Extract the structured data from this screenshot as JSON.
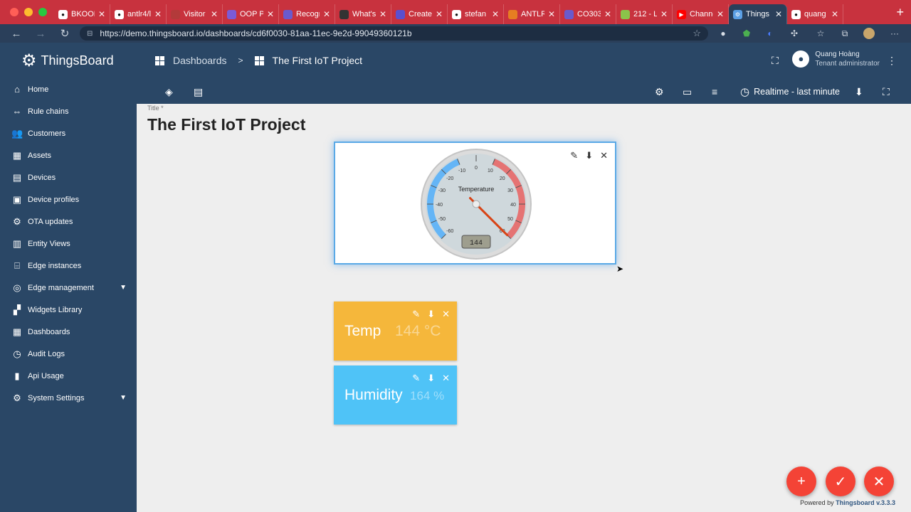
{
  "browser": {
    "tabs": [
      {
        "label": "BKOOL",
        "icon": "github-icon",
        "color": "#111111"
      },
      {
        "label": "antlr4/l",
        "icon": "github-icon",
        "color": "#111111"
      },
      {
        "label": "Visitor",
        "icon": "page-icon",
        "color": "#b33a3a"
      },
      {
        "label": "OOP Pr",
        "icon": "page-icon",
        "color": "#7b5bd6"
      },
      {
        "label": "Recogn",
        "icon": "page-icon",
        "color": "#6a5acd"
      },
      {
        "label": "What's",
        "icon": "page-icon",
        "color": "#333333"
      },
      {
        "label": "Create",
        "icon": "page-icon",
        "color": "#5a4fcf"
      },
      {
        "label": "stefan",
        "icon": "github-icon",
        "color": "#111111"
      },
      {
        "label": "ANTLR",
        "icon": "page-icon",
        "color": "#e67e22"
      },
      {
        "label": "CO303",
        "icon": "page-icon",
        "color": "#6a5acd"
      },
      {
        "label": "212 - L",
        "icon": "page-icon",
        "color": "#8bc34a"
      },
      {
        "label": "Channe",
        "icon": "youtube-icon",
        "color": "#ff0000"
      },
      {
        "label": "Things",
        "icon": "gear-icon",
        "color": "#5ba0e6",
        "active": true
      },
      {
        "label": "quang",
        "icon": "github-icon",
        "color": "#111111"
      }
    ],
    "url": "https://demo.thingsboard.io/dashboards/cd6f0030-81aa-11ec-9e2d-99049360121b"
  },
  "app": {
    "brand": "ThingsBoard",
    "breadcrumb": {
      "parent": "Dashboards",
      "separator": ">",
      "current": "The First IoT Project"
    },
    "user": {
      "name": "Quang Hoàng",
      "role": "Tenant administrator"
    },
    "timewindow": "Realtime - last minute"
  },
  "sidebar": {
    "items": [
      {
        "label": "Home",
        "icon": "home-icon",
        "glyph": "⌂"
      },
      {
        "label": "Rule chains",
        "icon": "rule-chain-icon",
        "glyph": "⇔"
      },
      {
        "label": "Customers",
        "icon": "customers-icon",
        "glyph": "👥"
      },
      {
        "label": "Assets",
        "icon": "assets-icon",
        "glyph": "▦"
      },
      {
        "label": "Devices",
        "icon": "devices-icon",
        "glyph": "▤"
      },
      {
        "label": "Device profiles",
        "icon": "device-profiles-icon",
        "glyph": "▣"
      },
      {
        "label": "OTA updates",
        "icon": "ota-icon",
        "glyph": "⚙"
      },
      {
        "label": "Entity Views",
        "icon": "entity-views-icon",
        "glyph": "▥"
      },
      {
        "label": "Edge instances",
        "icon": "edge-icon",
        "glyph": "⌸"
      },
      {
        "label": "Edge management",
        "icon": "edge-management-icon",
        "glyph": "◎",
        "expandable": true
      },
      {
        "label": "Widgets Library",
        "icon": "widgets-icon",
        "glyph": "▞"
      },
      {
        "label": "Dashboards",
        "icon": "dashboards-icon",
        "glyph": "▦"
      },
      {
        "label": "Audit Logs",
        "icon": "audit-icon",
        "glyph": "◷"
      },
      {
        "label": "Api Usage",
        "icon": "api-usage-icon",
        "glyph": "▮"
      },
      {
        "label": "System Settings",
        "icon": "settings-icon",
        "glyph": "⚙",
        "expandable": true
      }
    ]
  },
  "dashboard": {
    "title_label": "Title *",
    "title": "The First IoT Project",
    "gauge": {
      "label": "Temperature",
      "value": 144,
      "min": -60,
      "max": 60,
      "ticks": [
        "-60",
        "-50",
        "-40",
        "-30",
        "-20",
        "-10",
        "0",
        "10",
        "20",
        "30",
        "40",
        "50",
        "60"
      ]
    },
    "temp_card": {
      "label": "Temp",
      "value": "144 °C"
    },
    "humidity_card": {
      "label": "Humidity",
      "value": "164 %"
    }
  },
  "footer": {
    "powered_prefix": "Powered by",
    "powered_brand": "Thingsboard v.3.3.3"
  }
}
